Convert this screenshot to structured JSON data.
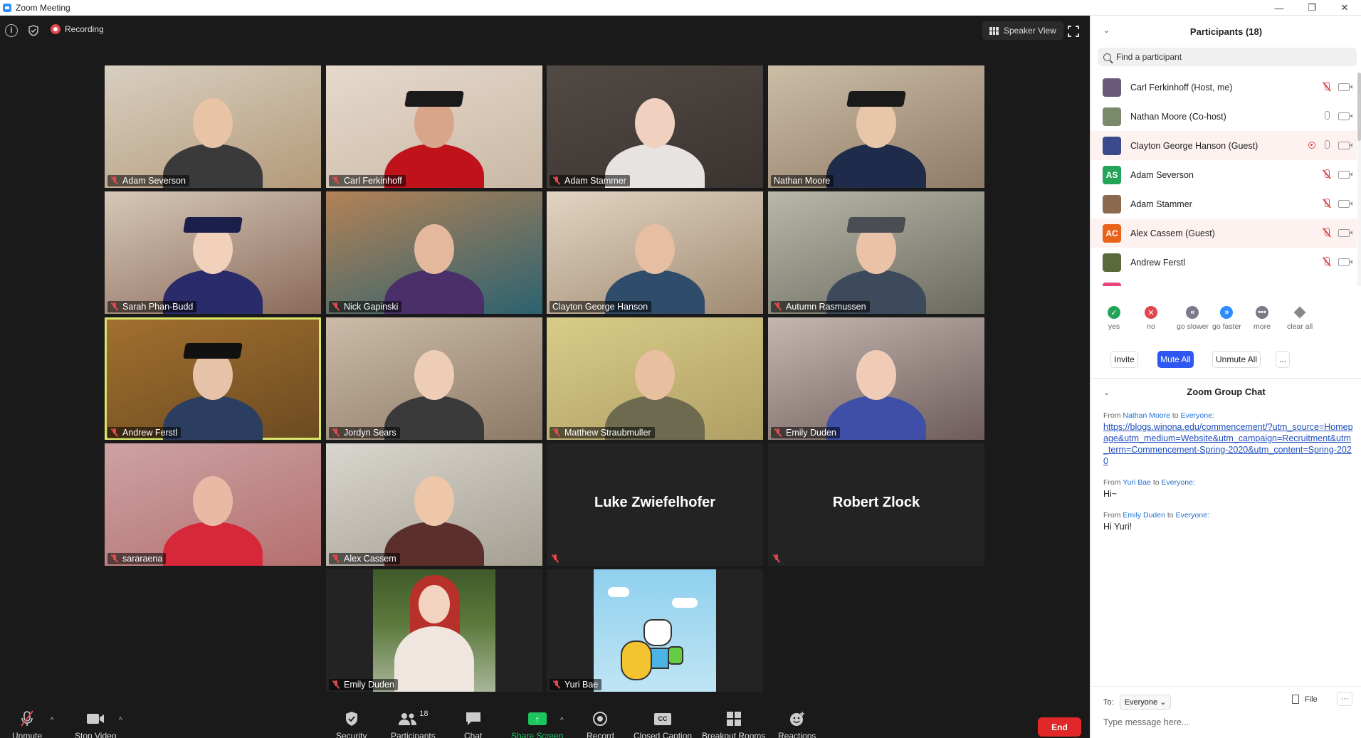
{
  "window": {
    "title": "Zoom Meeting",
    "controls": [
      "—",
      "❐",
      "✕"
    ]
  },
  "topbar": {
    "recording_label": "Recording",
    "speaker_view_label": "Speaker View"
  },
  "tiles": [
    {
      "name": "Adam Severson",
      "muted": true,
      "bg": "#b49a7a",
      "wall": "#d8cfc0",
      "head": "#e8c3a6",
      "shirt": "#3a3a3a",
      "cap": ""
    },
    {
      "name": "Carl Ferkinhoff",
      "muted": true,
      "bg": "#c9b8a5",
      "wall": "#e6d9cc",
      "head": "#d8a58a",
      "shirt": "#c0121a",
      "cap": "#1a1a1a"
    },
    {
      "name": "Adam Stammer",
      "muted": true,
      "bg": "#3a3330",
      "wall": "#524a44",
      "head": "#f0d0be",
      "shirt": "#e7e3e1",
      "cap": ""
    },
    {
      "name": "Nathan Moore",
      "muted": false,
      "bg": "#8f7b66",
      "wall": "#cdbda6",
      "head": "#e8c6aa",
      "shirt": "#1e2b4a",
      "cap": "#1a1a1a"
    },
    {
      "name": "Sarah Phan-Budd",
      "muted": true,
      "bg": "#8b6a5a",
      "wall": "#d6c8b8",
      "head": "#f1d1bc",
      "shirt": "#2a2b6a",
      "cap": "#1c1f4a"
    },
    {
      "name": "Nick Gapinski",
      "muted": true,
      "bg": "#2c6270",
      "wall": "#b38256",
      "head": "#e3b89c",
      "shirt": "#4b2f6a",
      "cap": ""
    },
    {
      "name": "Clayton George Hanson",
      "muted": false,
      "bg": "#a08a72",
      "wall": "#e2d5c2",
      "head": "#e6bea2",
      "shirt": "#2f4d6b",
      "cap": ""
    },
    {
      "name": "Autumn Rasmussen",
      "muted": true,
      "bg": "#6a6a5e",
      "wall": "#b9b7aa",
      "head": "#e9c2a8",
      "shirt": "#3c4a5c",
      "cap": "#4a4d52"
    },
    {
      "name": "Andrew Ferstl",
      "muted": true,
      "bg": "#6b4a21",
      "wall": "#a3702f",
      "head": "#e5c2a8",
      "shirt": "#2c3e60",
      "cap": "#111111",
      "active": true
    },
    {
      "name": "Jordyn Sears",
      "muted": true,
      "bg": "#8d7a66",
      "wall": "#cbbba8",
      "head": "#edcdb6",
      "shirt": "#3a3a3a",
      "cap": ""
    },
    {
      "name": "Matthew Straubmuller",
      "muted": true,
      "bg": "#b09f64",
      "wall": "#d8cc8a",
      "head": "#e8c0a0",
      "shirt": "#6d6a4f",
      "cap": ""
    },
    {
      "name": "Emily Duden",
      "muted": true,
      "bg": "#6d5c5a",
      "wall": "#c4b7b1",
      "head": "#f0cbb5",
      "shirt": "#3f4fa8",
      "cap": ""
    },
    {
      "name": "sararaena",
      "muted": true,
      "bg": "#b4706e",
      "wall": "#cda2a4",
      "head": "#e9b9a5",
      "shirt": "#d7283a",
      "cap": ""
    },
    {
      "name": "Alex Cassem",
      "muted": true,
      "bg": "#a59f92",
      "wall": "#d9d6cf",
      "head": "#eec6a8",
      "shirt": "#5a2f2c",
      "cap": ""
    },
    {
      "name": "Luke Zwiefelhofer",
      "muted": true,
      "big": true
    },
    {
      "name": "Robert Zlock",
      "muted": true,
      "big": true
    },
    {
      "name": "Emily Duden",
      "muted": true,
      "portrait": "ariel"
    },
    {
      "name": "Yuri Bae",
      "muted": true,
      "portrait": "cartoon"
    }
  ],
  "toolbar": {
    "unmute": "Unmute",
    "stop_video": "Stop Video",
    "security": "Security",
    "participants": "Participants",
    "participants_count": "18",
    "chat": "Chat",
    "share_screen": "Share Screen",
    "record": "Record",
    "closed_caption": "Closed Caption",
    "cc_glyph": "CC",
    "breakout_rooms": "Breakout Rooms",
    "reactions": "Reactions",
    "end": "End"
  },
  "participants_panel": {
    "title": "Participants (18)",
    "search_placeholder": "Find a participant",
    "list": [
      {
        "name": "Carl Ferkinhoff (Host, me)",
        "avatar_color": "#6b5b7a",
        "initials": "",
        "mic": "off",
        "highlight": false,
        "rec": false
      },
      {
        "name": "Nathan Moore (Co-host)",
        "avatar_color": "#7a8a6a",
        "initials": "",
        "mic": "on",
        "highlight": false,
        "rec": false
      },
      {
        "name": "Clayton George Hanson (Guest)",
        "avatar_color": "#3b4a8a",
        "initials": "",
        "mic": "on",
        "highlight": true,
        "rec": true
      },
      {
        "name": "Adam Severson",
        "avatar_color": "#23a559",
        "initials": "AS",
        "mic": "off",
        "highlight": false,
        "rec": false
      },
      {
        "name": "Adam Stammer",
        "avatar_color": "#8a6a50",
        "initials": "",
        "mic": "off",
        "highlight": false,
        "rec": false
      },
      {
        "name": "Alex Cassem (Guest)",
        "avatar_color": "#e8621a",
        "initials": "AC",
        "mic": "off",
        "highlight": true,
        "rec": false
      },
      {
        "name": "Andrew Ferstl",
        "avatar_color": "#5a6a3a",
        "initials": "",
        "mic": "off",
        "highlight": false,
        "rec": false
      }
    ],
    "reactions": [
      {
        "label": "yes",
        "glyph": "✓",
        "color": "#23a559"
      },
      {
        "label": "no",
        "glyph": "✕",
        "color": "#e0484d"
      },
      {
        "label": "go slower",
        "glyph": "«",
        "color": "#7a7a8a"
      },
      {
        "label": "go faster",
        "glyph": "»",
        "color": "#2d8cff"
      },
      {
        "label": "more",
        "glyph": "•••",
        "color": "#7a7a8a"
      },
      {
        "label": "clear all",
        "glyph": "",
        "color": "#888888"
      }
    ],
    "buttons": {
      "invite": "Invite",
      "mute_all": "Mute All",
      "unmute_all": "Unmute All",
      "more": "..."
    }
  },
  "chat_panel": {
    "title": "Zoom Group Chat",
    "messages": [
      {
        "from_label": "From",
        "sender": "Nathan Moore",
        "to_label": "to",
        "recipient": "Everyone:",
        "text": "https://blogs.winona.edu/commencement/?utm_source=Homepage&utm_medium=Website&utm_campaign=Recruitment&utm_term=Commencement-Spring-2020&utm_content=Spring-2020",
        "is_link": true
      },
      {
        "from_label": "From",
        "sender": "Yuri Bae",
        "to_label": "to",
        "recipient": "Everyone:",
        "text": "Hi~",
        "is_link": false
      },
      {
        "from_label": "From",
        "sender": "Emily Duden",
        "to_label": "to",
        "recipient": "Everyone:",
        "text": "Hi Yuri!",
        "is_link": false
      }
    ],
    "to_label": "To:",
    "to_value": "Everyone",
    "file_label": "File",
    "more_label": "···",
    "input_placeholder": "Type message here..."
  }
}
